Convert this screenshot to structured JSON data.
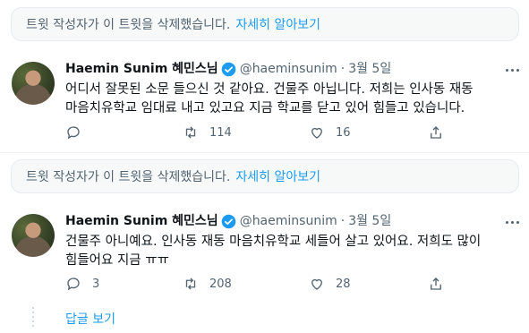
{
  "notice": {
    "text": "트윗 작성자가 이 트윗을 삭제했습니다.",
    "link": "자세히 알아보기"
  },
  "tweets": [
    {
      "name": "Haemin Sunim 혜민스님",
      "handle": "@haeminsunim",
      "dot": "·",
      "date": "3월 5일",
      "text": "어디서 잘못된 소문 들으신 것 같아요. 건물주 아닙니다. 저희는 인사동 재동\n마음치유학교 임대료 내고 있고요 지금 학교를 닫고 있어 힘들고 있습니다.",
      "reply_count": "",
      "retweet_count": "114",
      "like_count": "16"
    },
    {
      "name": "Haemin Sunim 혜민스님",
      "handle": "@haeminsunim",
      "dot": "·",
      "date": "3월 5일",
      "text": "건물주 아니예요. 인사동 재동 마음치유학교 세들어 살고 있어요. 저희도 많이\n힘들어요 지금 ㅠㅠ",
      "reply_count": "3",
      "retweet_count": "208",
      "like_count": "28"
    }
  ],
  "thread": {
    "show_replies": "답글 보기"
  },
  "colors": {
    "link": "#1d9bf0",
    "muted": "#536471",
    "verified": "#1d9bf0"
  },
  "icons": [
    "reply-icon",
    "retweet-icon",
    "like-icon",
    "share-icon",
    "verified-badge-icon",
    "more-icon"
  ]
}
